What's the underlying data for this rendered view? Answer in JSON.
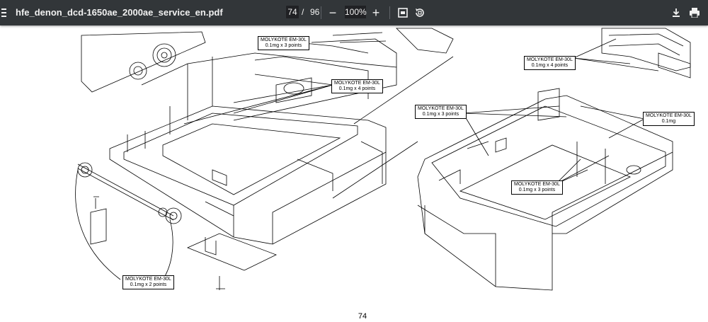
{
  "toolbar": {
    "filename": "hfe_denon_dcd-1650ae_2000ae_service_en.pdf",
    "current_page": "74",
    "page_separator": "/",
    "total_pages": "96",
    "zoom": "100%",
    "zoom_out_symbol": "−",
    "zoom_in_symbol": "+",
    "icons": [
      "menu-icon",
      "fit-page-icon",
      "rotate-icon",
      "download-icon",
      "print-icon"
    ]
  },
  "page": {
    "page_number": "74",
    "callouts": [
      {
        "line1": "MOLYKOTE EM-30L",
        "line2": "0.1mg x 3 points"
      },
      {
        "line1": "MOLYKOTE EM-30L",
        "line2": "0.1mg x 4 points"
      },
      {
        "line1": "MOLYKOTE EM-30L",
        "line2": "0.1mg x 2 points"
      },
      {
        "line1": "MOLYKOTE EM-30L",
        "line2": "0.1mg x 4 points"
      },
      {
        "line1": "MOLYKOTE EM-30L",
        "line2": "0.1mg x 3 points"
      },
      {
        "line1": "MOLYKOTE EM-30L",
        "line2": "0.1mg"
      },
      {
        "line1": "MOLYKOTE EM-30L",
        "line2": "0.1mg x 3 points"
      }
    ]
  }
}
